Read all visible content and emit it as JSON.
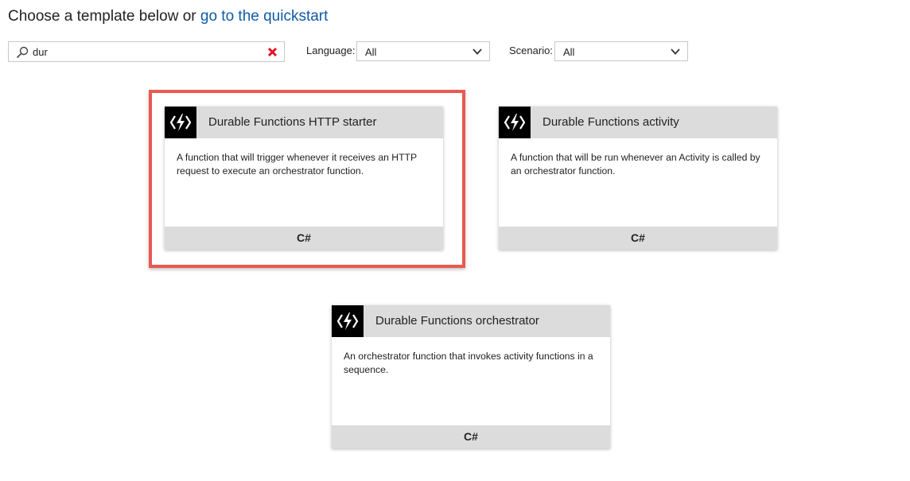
{
  "header": {
    "prefix": "Choose a template below or",
    "link": "go to the quickstart"
  },
  "search": {
    "value": "dur",
    "placeholder": ""
  },
  "filters": {
    "language_label": "Language:",
    "language_value": "All",
    "scenario_label": "Scenario:",
    "scenario_value": "All"
  },
  "highlight_color": "#e85a50",
  "templates": [
    {
      "title": "Durable Functions HTTP starter",
      "description": "A function that will trigger whenever it receives an HTTP request to execute an orchestrator function.",
      "language": "C#",
      "icon": "azure-functions-icon",
      "selected": true
    },
    {
      "title": "Durable Functions activity",
      "description": "A function that will be run whenever an Activity is called by an orchestrator function.",
      "language": "C#",
      "icon": "azure-functions-icon",
      "selected": false
    },
    {
      "title": "Durable Functions orchestrator",
      "description": "An orchestrator function that invokes activity functions in a sequence.",
      "language": "C#",
      "icon": "azure-functions-icon",
      "selected": false
    }
  ]
}
